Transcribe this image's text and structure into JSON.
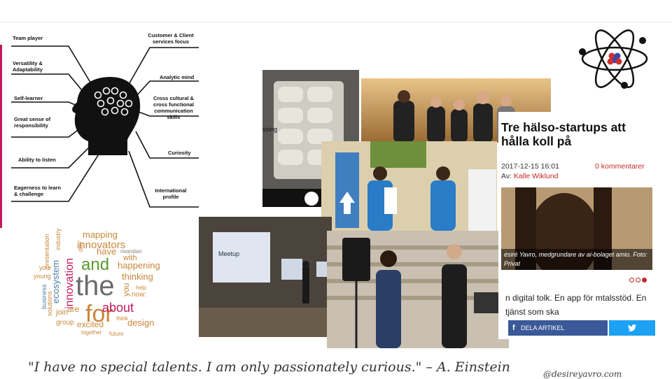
{
  "mindmap": {
    "labels_left": [
      "Team player",
      "Versatility & Adaptability",
      "Self-learner",
      "Great sense of responsibility",
      "Ability to listen",
      "Eagerness to learn & challenge"
    ],
    "labels_right": [
      "Customer & Client services focus",
      "Analytic mind",
      "Cross cultural & cross functional communication skills",
      "Curiosity",
      "International profile"
    ]
  },
  "wordcloud": {
    "words": [
      "mapping",
      "innovators",
      "and",
      "the",
      "for",
      "about",
      "innovation",
      "ecosystem",
      "happening",
      "thinking",
      "have",
      "with",
      "rwandan",
      "design",
      "excited",
      "group",
      "join",
      "are",
      "help",
      "now:",
      "together",
      "future",
      "think",
      "day",
      "young",
      "your",
      "presentation",
      "industry",
      "business",
      "solutions",
      "you"
    ]
  },
  "photos": {
    "pills_overlay_text": "ssing",
    "room_screen_text": "Meetup"
  },
  "article": {
    "title": "Tre hälso-startups att hålla koll på",
    "date": "2017-12-15 16:01",
    "comments_count": "0",
    "comments_label": "kommentarer",
    "author_prefix": "Av:",
    "author": "Kalle Wiklund",
    "caption": "ésiré Yavro, medgrundare av ai-bolaget amio. Foto: Privat",
    "body": "n digital tolk. En app för mtalsstöd. En tjänst som ska",
    "share_facebook": "DELA ARTIKEL",
    "colors": {
      "accent": "#c62828",
      "facebook": "#3b5998",
      "twitter": "#1da1f2"
    }
  },
  "quote": "\"I have no special talents. I am only passionately curious.\" – A. Einstein",
  "handle": "@desireyavro.com"
}
